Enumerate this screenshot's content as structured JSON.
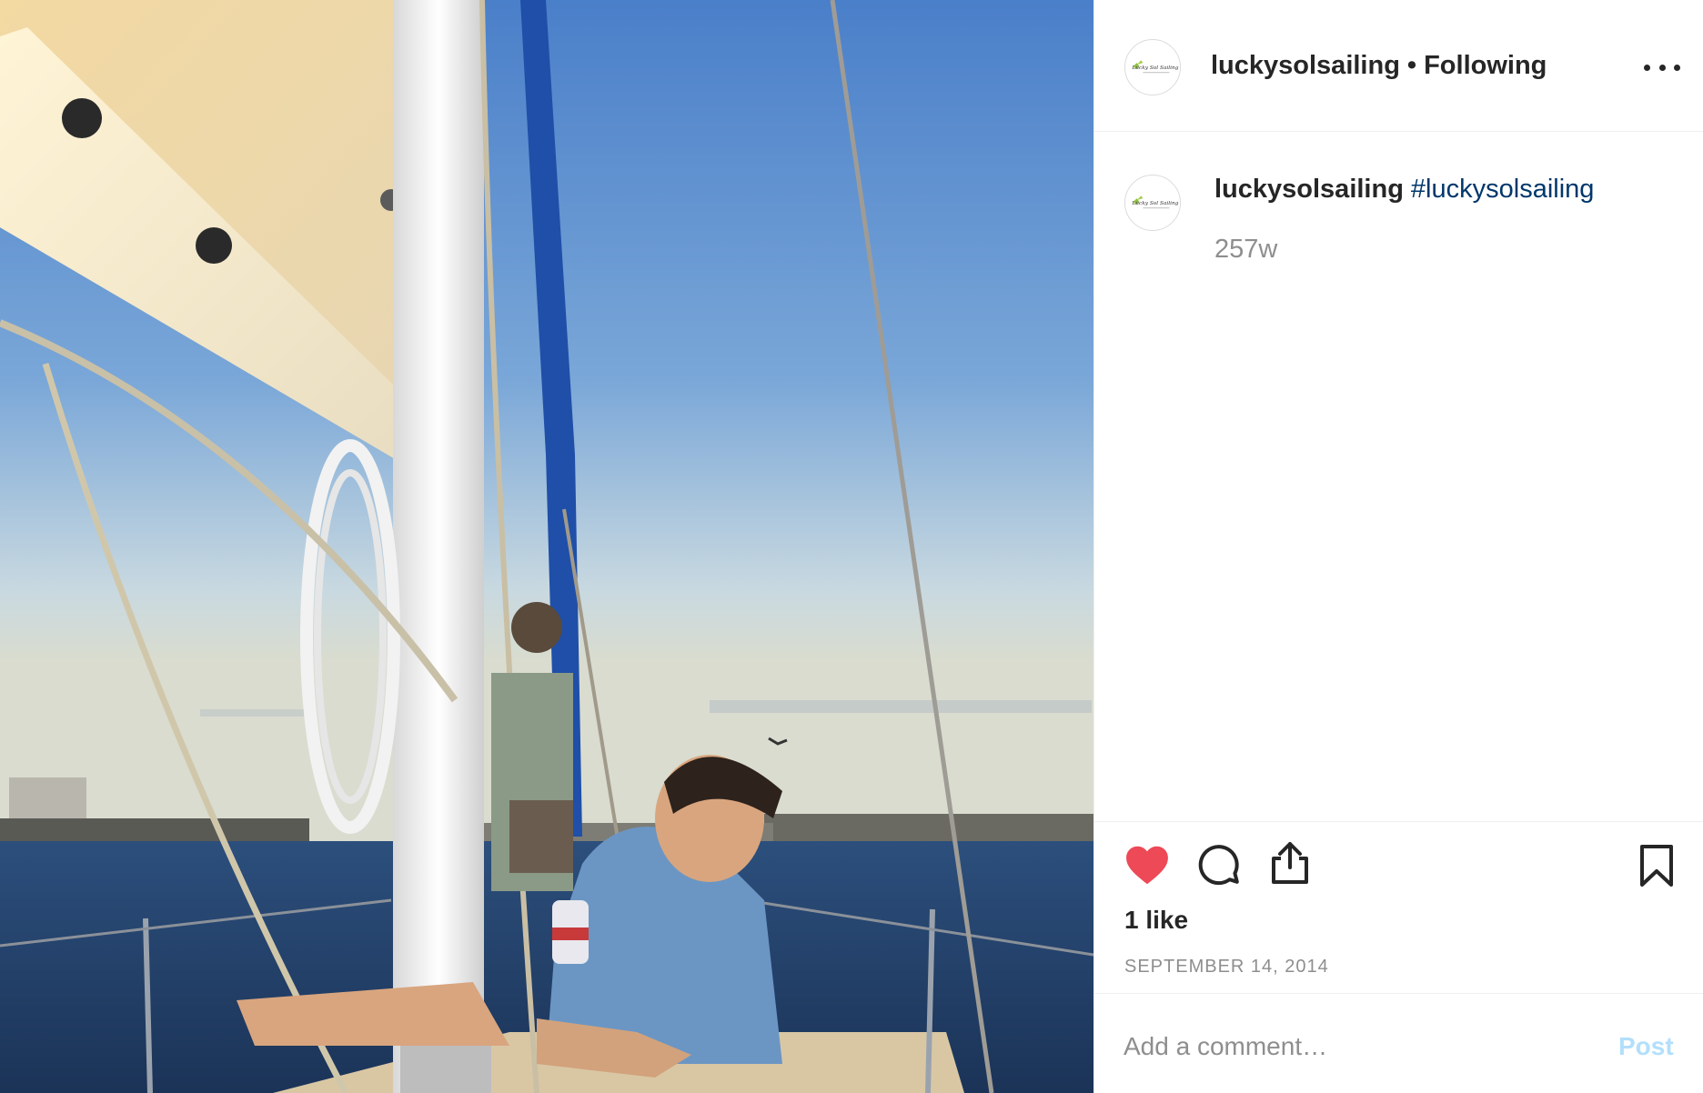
{
  "post": {
    "image_alt": "Man sitting on a sailboat deck holding a can, another man standing by the mast, sea and city skyline in background"
  },
  "header": {
    "username": "luckysolsailing",
    "separator": "•",
    "follow_status": "Following",
    "avatar_text": "Lucky Sol Sailing"
  },
  "caption": {
    "username": "luckysolsailing",
    "hashtag": "#luckysolsailing",
    "age": "257w"
  },
  "actions": {
    "likes": "1 like",
    "date": "SEPTEMBER 14, 2014"
  },
  "comment": {
    "placeholder": "Add a comment…",
    "post_label": "Post"
  },
  "colors": {
    "like_red": "#ed4956",
    "hashtag_blue": "#00376b",
    "post_disabled": "#b2dffc",
    "muted_gray": "#8e8e8e"
  },
  "icons": [
    "heart-icon",
    "comment-icon",
    "share-icon",
    "bookmark-icon",
    "more-options-icon"
  ]
}
